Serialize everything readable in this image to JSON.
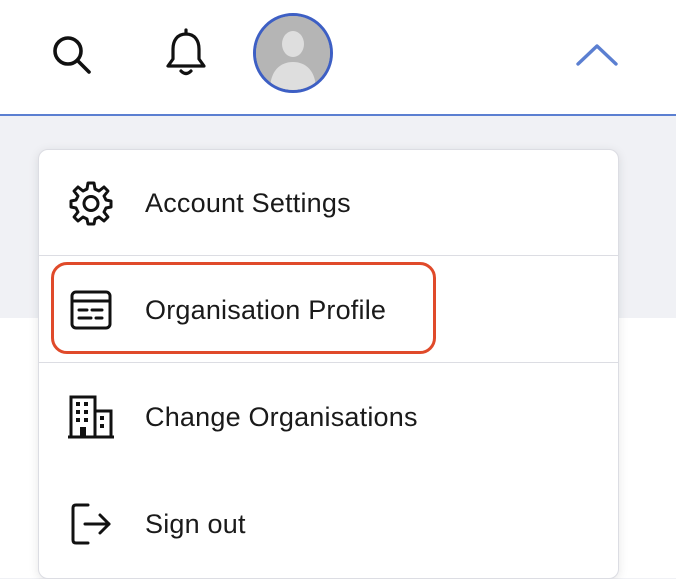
{
  "header": {
    "icons": {
      "search": "search-icon",
      "notifications": "bell-icon",
      "avatar": "user-avatar",
      "toggle": "chevron-up-icon"
    },
    "accent_color": "#5b7fd1"
  },
  "menu": {
    "items": [
      {
        "label": "Account Settings",
        "icon": "gear-icon"
      },
      {
        "label": "Organisation Profile",
        "icon": "profile-card-icon",
        "highlighted": true
      },
      {
        "label": "Change Organisations",
        "icon": "building-icon"
      },
      {
        "label": "Sign out",
        "icon": "sign-out-icon"
      }
    ],
    "highlight_color": "#e04a2a"
  }
}
